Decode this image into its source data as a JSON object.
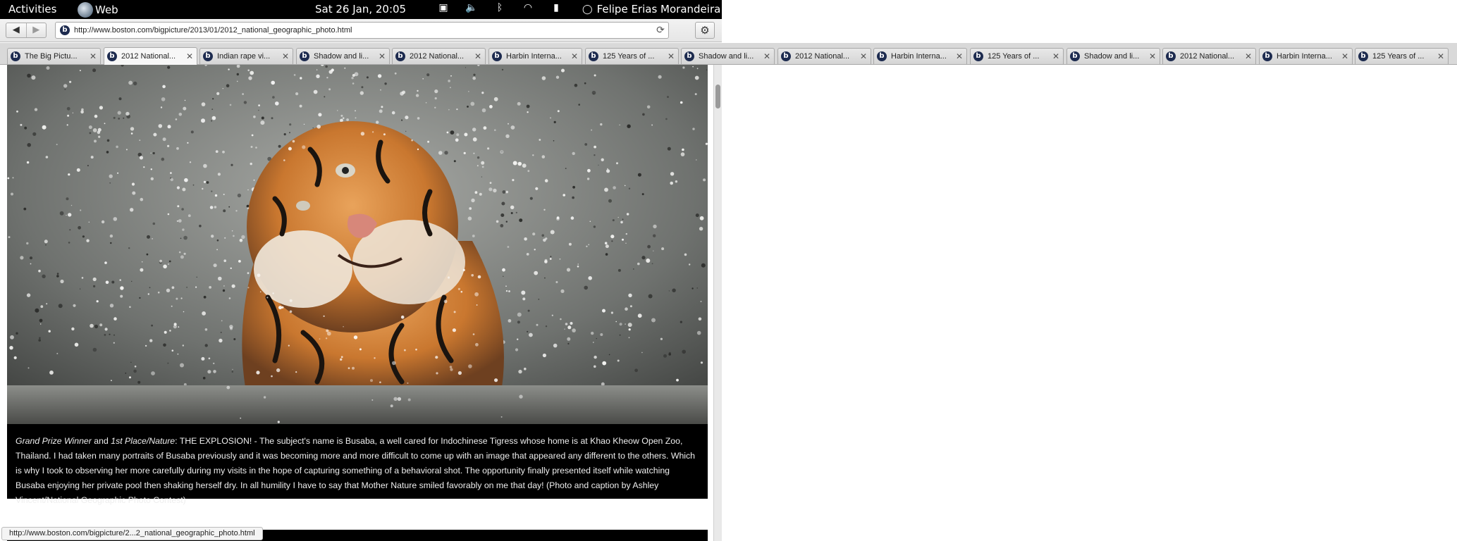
{
  "topbar": {
    "activities": "Activities",
    "app_name": "Web",
    "clock": "Sat 26 Jan, 20:05",
    "user": "Felipe Erias Morandeira",
    "indicators": [
      "chat-icon",
      "volume-icon",
      "bluetooth-icon",
      "wifi-icon",
      "battery-icon"
    ]
  },
  "toolbar": {
    "url": "http://www.boston.com/bigpicture/2013/01/2012_national_geographic_photo.html"
  },
  "tabs": [
    {
      "title": "The Big Pictu..."
    },
    {
      "title": "2012 National...",
      "active": true
    },
    {
      "title": "Indian rape vi..."
    },
    {
      "title": "Shadow and li..."
    },
    {
      "title": "2012 National..."
    },
    {
      "title": "Harbin Interna..."
    },
    {
      "title": "125 Years of ..."
    },
    {
      "title": "Shadow and li..."
    },
    {
      "title": "2012 National..."
    },
    {
      "title": "Harbin Interna..."
    },
    {
      "title": "125 Years of ..."
    },
    {
      "title": "Shadow and li..."
    },
    {
      "title": "2012 National..."
    },
    {
      "title": "Harbin Interna..."
    },
    {
      "title": "125 Years of ..."
    }
  ],
  "tab_favicon_letter": "b",
  "caption": {
    "award1": "Grand Prize Winner",
    "and": " and ",
    "award2": "1st Place/Nature",
    "text": ": THE EXPLOSION! - The subject's name is Busaba, a well cared for Indochinese Tigress whose home is at Khao Kheow Open Zoo, Thailand. I had taken many portraits of Busaba previously and it was becoming more and more difficult to come up with an image that appeared any different to the others. Which is why I took to observing her more carefully during my visits in the hope of capturing something of a behavioral shot. The opportunity finally presented itself while watching Busaba enjoying her private pool then shaking herself dry. In all humility I have to say that Mother Nature smiled favorably on me that day! (Photo and caption by Ashley Vincent/National Geographic Photo Contest)"
  },
  "status_link": "http://www.boston.com/bigpicture/2...2_national_geographic_photo.html",
  "colors": {
    "topbar": "#000000",
    "caption_bg": "#000000",
    "favicon": "#1d2b4f"
  }
}
